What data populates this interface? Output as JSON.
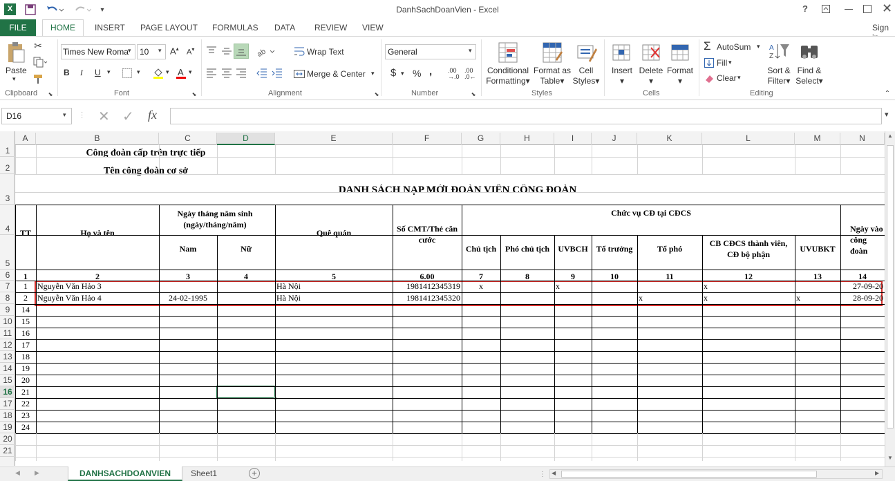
{
  "title": "DanhSachDoanVien - Excel",
  "tabs": [
    "FILE",
    "HOME",
    "INSERT",
    "PAGE LAYOUT",
    "FORMULAS",
    "DATA",
    "REVIEW",
    "VIEW"
  ],
  "signin": "Sign in",
  "ribbon": {
    "paste": "Paste",
    "font_name": "Times New Roma",
    "font_size": "10",
    "wrap_text": "Wrap Text",
    "merge_center": "Merge & Center",
    "number_format": "General",
    "cond1": "Conditional",
    "cond2": "Formatting",
    "fmt_table1": "Format as",
    "fmt_table2": "Table",
    "cell_styles1": "Cell",
    "cell_styles2": "Styles",
    "insert": "Insert",
    "delete": "Delete",
    "format": "Format",
    "autosum": "AutoSum",
    "fill": "Fill",
    "clear": "Clear",
    "sort1": "Sort &",
    "sort2": "Filter",
    "find1": "Find &",
    "find2": "Select",
    "groups": [
      "Clipboard",
      "Font",
      "Alignment",
      "Number",
      "Styles",
      "Cells",
      "Editing"
    ]
  },
  "namebox": "D16",
  "formula": "",
  "columns": [
    "A",
    "B",
    "C",
    "D",
    "E",
    "F",
    "G",
    "H",
    "I",
    "J",
    "K",
    "L",
    "M",
    "N"
  ],
  "row_numbers": [
    "1",
    "2",
    "3",
    "4",
    "5",
    "6",
    "7",
    "8",
    "9",
    "10",
    "11",
    "12",
    "13",
    "14",
    "15",
    "16",
    "17",
    "18",
    "19",
    "20",
    "21"
  ],
  "sheet": {
    "r1": "Công đoàn cấp trên trực tiếp",
    "r2": "Tên công đoàn cơ sở",
    "r3": "DANH SÁCH NẠP MỚI ĐOÀN VIÊN CÔNG ĐOÀN",
    "h_tt": "TT",
    "h_name": "Họ và tên",
    "h_dob": "Ngày tháng năm sinh (ngày/tháng/năm)",
    "h_nam": "Nam",
    "h_nu": "Nữ",
    "h_que": "Quê quán",
    "h_cmt": "Số CMT/Thẻ căn cước",
    "h_chucvu": "Chức vụ CĐ tại CĐCS",
    "h_chutich": "Chủ tịch",
    "h_phochutich": "Phó chủ tịch",
    "h_uvbch": "UVBCH",
    "h_totruong": "Tổ trưởng",
    "h_topho": "Tổ phó",
    "h_cbcdcs": "CB CĐCS thành viên, CĐ bộ phận",
    "h_uvubkt": "UVUBKT",
    "h_ngayvao": "Ngày vào công đoàn",
    "nums": [
      "1",
      "2",
      "3",
      "4",
      "5",
      "6.00",
      "7",
      "8",
      "9",
      "10",
      "11",
      "12",
      "13",
      "14"
    ],
    "rows": [
      {
        "tt": "1",
        "name": "Nguyễn Văn Hảo 3",
        "nam": "",
        "que": "Hà Nội",
        "cmt": "1981412345319",
        "g": "x",
        "i": "x",
        "k": "",
        "l": "x",
        "m": "",
        "n": "27-09-20"
      },
      {
        "tt": "2",
        "name": "Nguyễn Văn Hảo 4",
        "nam": "24-02-1995",
        "que": "Hà Nội",
        "cmt": "1981412345320",
        "g": "",
        "i": "",
        "k": "x",
        "l": "x",
        "m": "x",
        "n": "28-09-20"
      }
    ],
    "tt_more": [
      "14",
      "15",
      "16",
      "17",
      "18",
      "19",
      "20",
      "21",
      "22",
      "23",
      "24"
    ]
  },
  "sheets": [
    "DANHSACHDOANVIEN",
    "Sheet1"
  ],
  "colors": {
    "excel_green": "#217346",
    "selection": "#217346",
    "highlight": "#d9302c"
  }
}
